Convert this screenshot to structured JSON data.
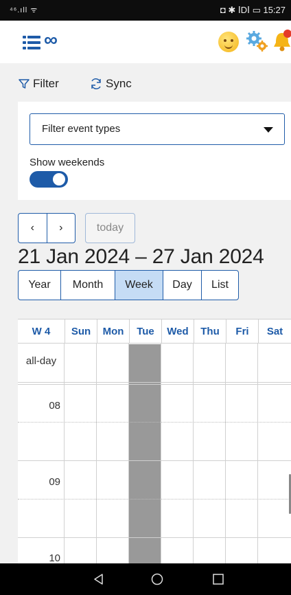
{
  "status_bar": {
    "signal_text": "⁴⁶.ıll ᯤ",
    "right_text": "◘ ✱ ⅠDⅠ ▭ 15:27"
  },
  "header": {
    "menu_icon": "list-icon",
    "logo_icon": "infinity-icon",
    "right_icons": [
      "emoji-icon",
      "gear-icon",
      "bell-icon"
    ],
    "brand_color": "#1e5ba8"
  },
  "toolbar": {
    "filter_label": "Filter",
    "sync_label": "Sync"
  },
  "filter_panel": {
    "select_placeholder": "Filter event types",
    "weekends_label": "Show weekends",
    "weekends_on": true
  },
  "nav": {
    "prev": "‹",
    "next": "›",
    "today": "today"
  },
  "title": "21 Jan 2024 – 27 Jan 2024",
  "views": [
    {
      "label": "Year"
    },
    {
      "label": "Month"
    },
    {
      "label": "Week",
      "active": true
    },
    {
      "label": "Day"
    },
    {
      "label": "List"
    }
  ],
  "calendar": {
    "week_label": "W 4",
    "days": [
      "Sun",
      "Mon",
      "Tue",
      "Wed",
      "Thu",
      "Fri",
      "Sat"
    ],
    "highlighted_day": "Tue",
    "allday_label": "all-day",
    "hours": [
      "08",
      "09",
      "10"
    ]
  },
  "system_nav": [
    "back-icon",
    "home-icon",
    "recents-icon"
  ]
}
